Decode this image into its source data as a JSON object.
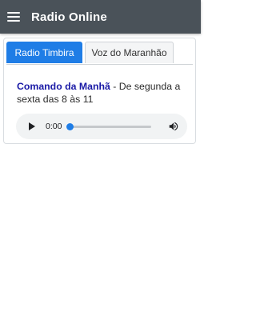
{
  "appbar": {
    "title": "Radio Online"
  },
  "tabs": [
    {
      "label": "Radio Timbira",
      "active": true
    },
    {
      "label": "Voz do Maranhão",
      "active": false
    }
  ],
  "program": {
    "name": "Comando da Manhã",
    "schedule": " - De segunda a sexta das 8 às 11"
  },
  "player": {
    "current_time": "0:00",
    "progress": 0
  },
  "icons": {
    "menu": "hamburger-menu-icon",
    "play": "play-icon",
    "volume": "volume-icon"
  },
  "colors": {
    "appbar": "#4a5259",
    "accent": "#1f7de6",
    "program_name": "#1a1aa6"
  }
}
